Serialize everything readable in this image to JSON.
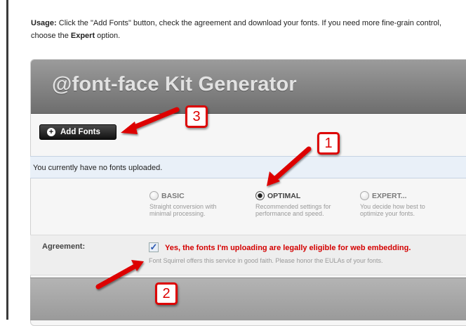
{
  "usage": {
    "prefix": "Usage:",
    "text_1": " Click the \"Add Fonts\" button, check the agreement and download your fonts. If you need more fine-grain control, choose the ",
    "expert": "Expert",
    "text_2": " option."
  },
  "panel": {
    "title": "@font-face Kit Generator"
  },
  "add_fonts": {
    "icon_glyph": "+",
    "label": "Add Fonts"
  },
  "notice": "You currently have no fonts uploaded.",
  "options": [
    {
      "name": "BASIC",
      "desc_1": "Straight conversion with",
      "desc_2": "minimal processing.",
      "selected": false
    },
    {
      "name": "OPTIMAL",
      "desc_1": "Recommended settings for",
      "desc_2": "performance and speed.",
      "selected": true
    },
    {
      "name": "EXPERT...",
      "desc_1": "You decide how best to",
      "desc_2": "optimize your fonts.",
      "selected": false
    }
  ],
  "agreement": {
    "label": "Agreement:",
    "checked": true,
    "check_glyph": "✓",
    "text": "Yes, the fonts I'm uploading are legally eligible for web embedding.",
    "sub": "Font Squirrel offers this service in good faith. Please honor the EULAs of your fonts."
  },
  "callouts": {
    "one": "1",
    "two": "2",
    "three": "3"
  },
  "colors": {
    "callout_red": "#dd0000",
    "agreement_red": "#d40000",
    "notice_bg": "#e9f0f8"
  }
}
